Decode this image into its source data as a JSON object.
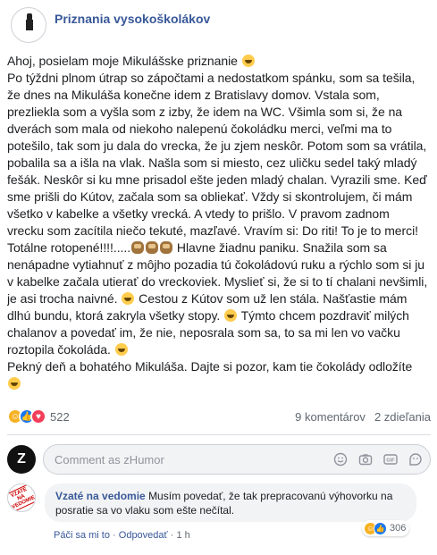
{
  "page": {
    "name": "Priznania vysokoškolákov",
    "avatar_caption": "Priznania vysokoškolákov"
  },
  "post": {
    "lines": [
      "Ahoj, posielam moje Mikulášske priznanie",
      "Po týždni plnom útrap so zápočtami a nedostatkom spánku, som sa tešila,",
      "že dnes na Mikuláša konečne idem z Bratislavy domov. Vstala som,",
      "prezliekla som a vyšla som z izby, že idem na WC. Všimla som si, že na",
      "dverách som mala od niekoho nalepenú čokoládku merci, veľmi ma to",
      "potešilo, tak som ju dala do vrecka, že ju zjem neskôr. Potom som sa vrátila,",
      "pobalila sa a išla na vlak. Našla som si miesto, cez uličku sedel taký mladý",
      "fešák. Neskôr si ku mne prisadol ešte jeden mladý chalan. Vyrazili sme. Keď",
      "sme prišli do Kútov, začala som sa obliekať. Vždy si skontrolujem, či mám",
      "všetko v kabelke a všetky vrecká. A vtedy to prišlo. V pravom zadnom",
      "vrecku som zacítila niečo tekuté, mazľavé. Vravím si: Do riti! To je to merci!",
      "Totálne rotopené!!!!.....",
      "nenápadne vytiahnuť z môjho pozadia tú čokoládovú ruku a rýchlo som si ju",
      "v kabelke začala utierať do vreckoviek. Myslieť si, že si to tí chalani nevšimli,",
      "je asi trocha naivné.",
      "dlhú bundu, ktorá zakryla všetky stopy.",
      "chalanov a povedať im, že nie, neposrala som sa, to sa mi len vo vačku",
      "roztopila čokoláda.",
      "Pekný deň a bohatého Mikuláša. Dajte si pozor, kam tie čokolády odložíte"
    ],
    "line12_tail": " Hlavne žiadnu paniku. Snažila som sa",
    "line15_tail": " Cestou z Kútov som už len stála. Našťastie mám",
    "line16_tail": " Týmto chcem pozdraviť milých"
  },
  "stats": {
    "reactions": "522",
    "comments": "9 komentárov",
    "shares": "2 zdieľania"
  },
  "composer": {
    "placeholder": "Comment as zHumor",
    "avatar_letter": "Z"
  },
  "comment": {
    "author": "Vzaté na vedomie",
    "text": "Musím povedať, že tak prepracovanú výhovorku na posratie sa vo vlaku som ešte nečítal.",
    "like_label": "Páči sa mi to",
    "reply_label": "Odpovedať",
    "time": "1 h",
    "reactions": "306",
    "avatar_text": "VZATÉ NA VEDOMIE"
  },
  "colors": {
    "link": "#385898",
    "like": "#1877f2",
    "haha": "#f7b125",
    "love": "#f33e58"
  }
}
